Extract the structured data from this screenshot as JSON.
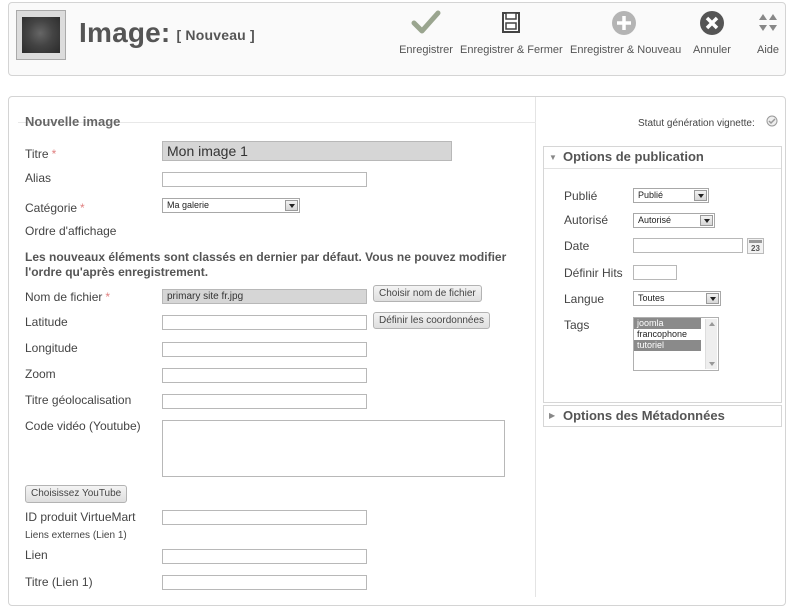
{
  "header": {
    "title": "Image:",
    "subtitle": "[ Nouveau ]"
  },
  "toolbar": {
    "save": "Enregistrer",
    "save_close": "Enregistrer & Fermer",
    "save_new": "Enregistrer & Nouveau",
    "cancel": "Annuler",
    "help": "Aide"
  },
  "form": {
    "legend": "Nouvelle image",
    "title_label": "Titre",
    "title_value": "Mon image 1",
    "alias_label": "Alias",
    "alias_value": "",
    "category_label": "Catégorie",
    "category_value": "Ma galerie",
    "ordering_label": "Ordre d'affichage",
    "ordering_note": "Les nouveaux éléments sont classés en dernier par défaut. Vous ne pouvez modifier l'ordre qu'après enregistrement.",
    "filename_label": "Nom de fichier",
    "filename_value": "primary site fr.jpg",
    "choose_file_btn": "Choisir nom de fichier",
    "latitude_label": "Latitude",
    "define_coords_btn": "Définir les coordonnées",
    "longitude_label": "Longitude",
    "zoom_label": "Zoom",
    "geo_title_label": "Titre géolocalisation",
    "video_label": "Code vidéo (Youtube)",
    "choose_youtube_btn": "Choisissez YouTube",
    "virtuemart_label": "ID produit VirtueMart",
    "external_links_label": "Liens externes (Lien 1)",
    "link_label": "Lien",
    "link_title_label": "Titre (Lien 1)",
    "required_mark": "*"
  },
  "right": {
    "status_label": "Statut génération vignette:",
    "publish_options": "Options de publication",
    "published_label": "Publié",
    "published_value": "Publié",
    "authorized_label": "Autorisé",
    "authorized_value": "Autorisé",
    "date_label": "Date",
    "hits_label": "Définir Hits",
    "language_label": "Langue",
    "language_value": "Toutes",
    "tags_label": "Tags",
    "tags": [
      "joomla",
      "francophone",
      "tutoriel"
    ],
    "metadata_options": "Options des Métadonnées",
    "calendar_day": "23"
  },
  "colors": {
    "check_green": "#9aa58f",
    "icon_gray": "#555555",
    "selected_tag": "#8a8a8a"
  }
}
